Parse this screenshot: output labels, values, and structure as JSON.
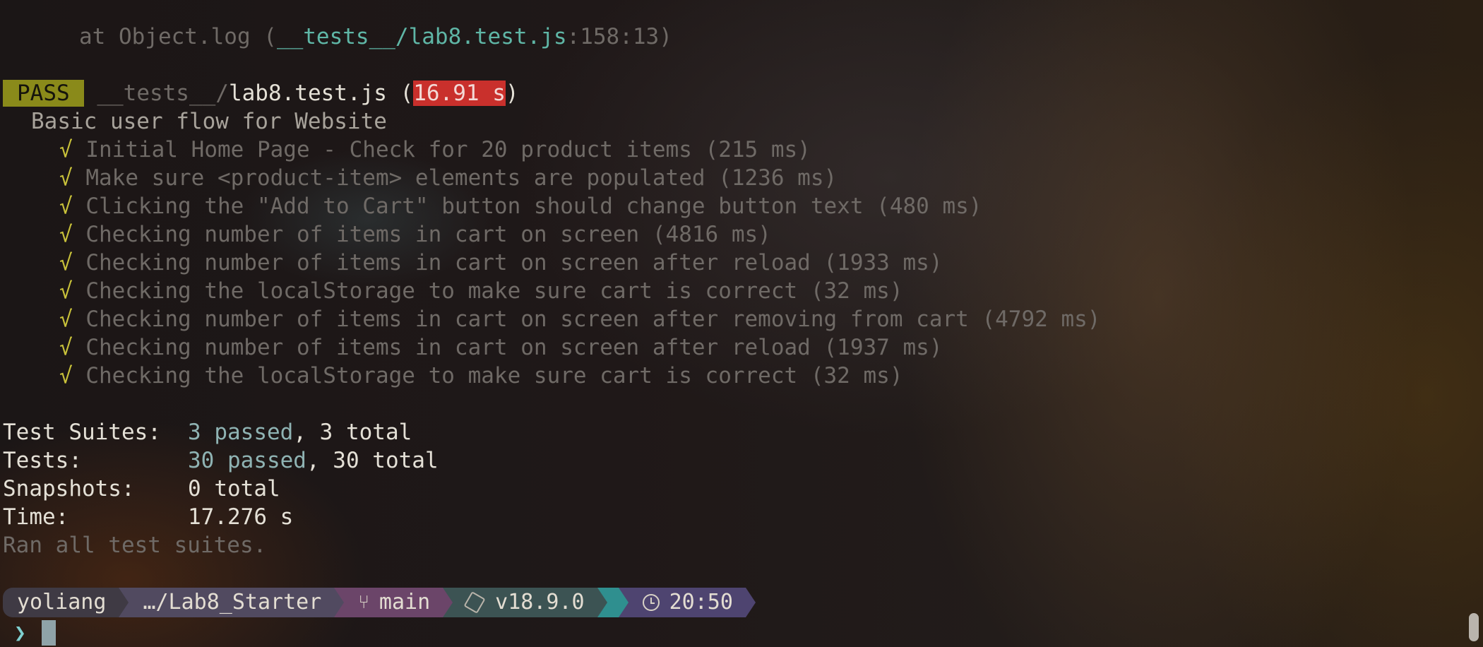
{
  "log_line": {
    "prefix": "      at Object.log (",
    "file": "__tests__/lab8.test.js",
    "location": ":158:13",
    "suffix": ")"
  },
  "result": {
    "status": "PASS",
    "file_dir": "__tests__/",
    "file_name": "lab8.test.js",
    "duration": "16.91 s"
  },
  "suite_name": "Basic user flow for Website",
  "tests": [
    {
      "mark": "√",
      "text": "Initial Home Page - Check for 20 product items (215 ms)"
    },
    {
      "mark": "√",
      "text": "Make sure <product-item> elements are populated (1236 ms)"
    },
    {
      "mark": "√",
      "text": "Clicking the \"Add to Cart\" button should change button text (480 ms)"
    },
    {
      "mark": "√",
      "text": "Checking number of items in cart on screen (4816 ms)"
    },
    {
      "mark": "√",
      "text": "Checking number of items in cart on screen after reload (1933 ms)"
    },
    {
      "mark": "√",
      "text": "Checking the localStorage to make sure cart is correct (32 ms)"
    },
    {
      "mark": "√",
      "text": "Checking number of items in cart on screen after removing from cart (4792 ms)"
    },
    {
      "mark": "√",
      "text": "Checking number of items in cart on screen after reload (1937 ms)"
    },
    {
      "mark": "√",
      "text": "Checking the localStorage to make sure cart is correct (32 ms)"
    }
  ],
  "summary": {
    "suites_label": "Test Suites:",
    "suites_passed": "3 passed",
    "suites_total": ", 3 total",
    "tests_label": "Tests:",
    "tests_passed": "30 passed",
    "tests_total": ", 30 total",
    "snapshots_label": "Snapshots:",
    "snapshots_value": "0 total",
    "time_label": "Time:",
    "time_value": "17.276 s",
    "ran_all": "Ran all test suites."
  },
  "prompt": {
    "user": "yoliang",
    "path": "…/Lab8_Starter",
    "branch": "main",
    "node_version": "v18.9.0",
    "time": "20:50",
    "prompt_char": "❯",
    "git_icon": "git-branch-icon",
    "node_icon": "nodejs-icon",
    "clock_icon": "clock-icon"
  },
  "colors": {
    "pass_bg": "#8a8a1a",
    "duration_bg": "#c9302c",
    "check": "#c9c23a",
    "file_teal": "#5fb6a6"
  }
}
